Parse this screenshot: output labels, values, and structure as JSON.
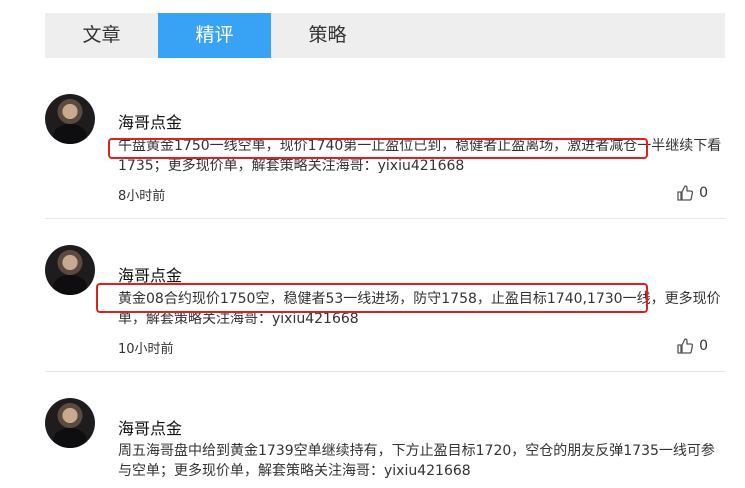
{
  "tabs": [
    {
      "label": "文章",
      "active": false
    },
    {
      "label": "精评",
      "active": true
    },
    {
      "label": "策略",
      "active": false
    }
  ],
  "posts": [
    {
      "author": "海哥点金",
      "content": "午盘黄金1750一线空单，现价1740第一止盈位已到，稳健者止盈离场，激进者减仓一半继续下看1735；更多现价单，解套策略关注海哥：yixiu421668",
      "time": "8小时前",
      "likes": "0"
    },
    {
      "author": "海哥点金",
      "content": "黄金08合约现价1750空，稳健者53一线进场，防守1758，止盈目标1740,1730一线，更多现价单，解套策略关注海哥：yixiu421668",
      "time": "10小时前",
      "likes": "0"
    },
    {
      "author": "海哥点金",
      "content": "周五海哥盘中给到黄金1739空单继续持有，下方止盈目标1720，空仓的朋友反弹1735一线可参与空单；更多现价单，解套策略关注海哥：yixiu421668"
    }
  ],
  "colors": {
    "tab_active": "#38a3f5",
    "tab_bar": "#eeeeee",
    "highlight": "#e0201f"
  },
  "icons": {
    "like": "thumbs-up-icon"
  }
}
